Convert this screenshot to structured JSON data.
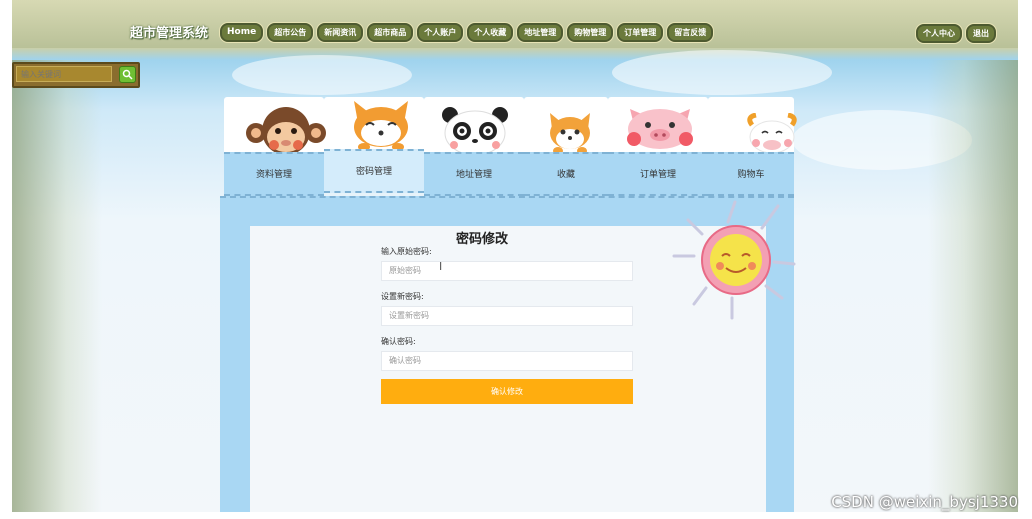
{
  "header": {
    "title": "超市管理系统",
    "nav": [
      "Home",
      "超市公告",
      "新闻资讯",
      "超市商品",
      "个人账户",
      "个人收藏",
      "地址管理",
      "购物管理",
      "订单管理",
      "留言反馈"
    ],
    "right_links": [
      "个人中心",
      "退出"
    ]
  },
  "search": {
    "placeholder": "输入关键词"
  },
  "tabs": [
    "资料管理",
    "密码管理",
    "地址管理",
    "收藏",
    "订单管理",
    "购物车"
  ],
  "form": {
    "title": "密码修改",
    "fields": [
      {
        "label": "输入原始密码:",
        "placeholder": "原始密码"
      },
      {
        "label": "设置新密码:",
        "placeholder": "设置新密码"
      },
      {
        "label": "确认密码:",
        "placeholder": "确认密码"
      }
    ],
    "submit": "确认修改"
  },
  "watermark": "CSDN @weixin_bysj1330",
  "colors": {
    "accent": "#ffad0f",
    "tab_bg": "#a9d7f3",
    "nav_bg": "#6b7a3c"
  }
}
